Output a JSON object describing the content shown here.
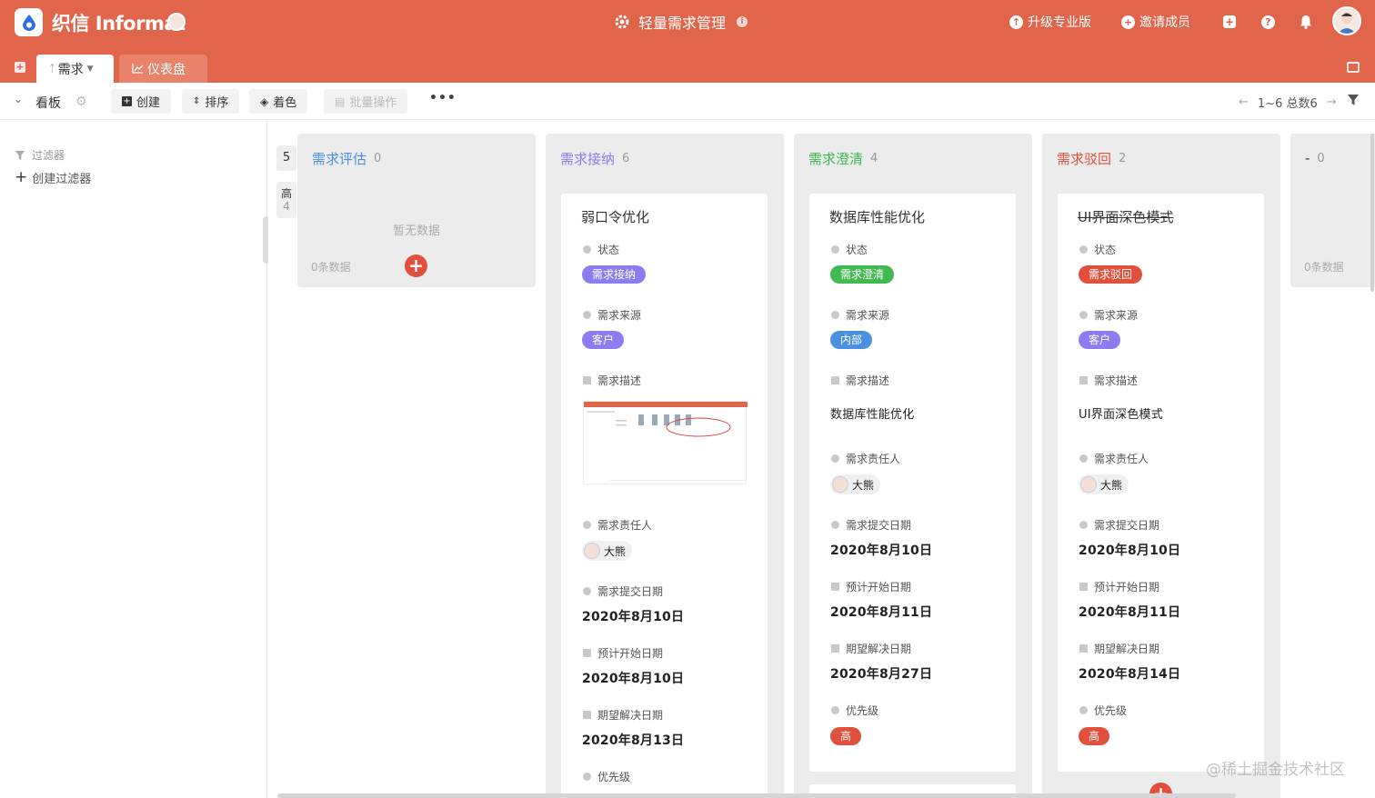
{
  "app": {
    "name": "织信 Informat",
    "title": "轻量需求管理",
    "upgrade_label": "升级专业版",
    "invite_label": "邀请成员",
    "brand_color": "#e0654a"
  },
  "tabs": [
    {
      "label": "需求"
    },
    {
      "label": "仪表盘"
    }
  ],
  "toolbar": {
    "view_label": "看板",
    "create_label": "创建",
    "sort_label": "排序",
    "color_label": "着色",
    "batch_label": "批量操作",
    "pager": "1~6 总数6"
  },
  "left": {
    "filter_label": "过滤器",
    "create_filter_label": "创建过滤器"
  },
  "group": {
    "count": "5",
    "label": "高",
    "label_count": "4"
  },
  "columns": [
    {
      "name": "需求评估",
      "count": "0",
      "color": "#4a90e2",
      "empty": "暂无数据",
      "zero": "0条数据"
    },
    {
      "name": "需求接纳",
      "count": "6",
      "color": "#8b7cf0"
    },
    {
      "name": "需求澄清",
      "count": "4",
      "color": "#3fb950"
    },
    {
      "name": "需求驳回",
      "count": "2",
      "color": "#e0503c"
    },
    {
      "name": "-",
      "count": "0",
      "color": "#333333",
      "zero": "0条数据"
    }
  ],
  "labels": {
    "status": "状态",
    "source": "需求来源",
    "desc": "需求描述",
    "owner": "需求责任人",
    "submit": "需求提交日期",
    "start": "预计开始日期",
    "due": "期望解决日期",
    "priority": "优先级"
  },
  "cards": [
    {
      "title": "弱口令优化",
      "status": "需求接纳",
      "status_color": "#8b7cf0",
      "source": "客户",
      "source_color": "#8b7cf0",
      "owner": "大熊",
      "submit": "2020年8月10日",
      "start": "2020年8月10日",
      "due": "2020年8月13日"
    },
    {
      "title": "数据库性能优化",
      "status": "需求澄清",
      "status_color": "#3fb950",
      "source": "内部",
      "source_color": "#4a90e2",
      "desc": "数据库性能优化",
      "owner": "大熊",
      "submit": "2020年8月10日",
      "start": "2020年8月11日",
      "due": "2020年8月27日",
      "priority": "高",
      "priority_color": "#e0503c"
    },
    {
      "title": "UI界面深色模式",
      "status": "需求驳回",
      "status_color": "#e0503c",
      "source": "客户",
      "source_color": "#8b7cf0",
      "desc": "UI界面深色模式",
      "owner": "大熊",
      "submit": "2020年8月10日",
      "start": "2020年8月11日",
      "due": "2020年8月14日",
      "priority": "高",
      "priority_color": "#e0503c"
    }
  ],
  "watermark": "@稀土掘金技术社区"
}
